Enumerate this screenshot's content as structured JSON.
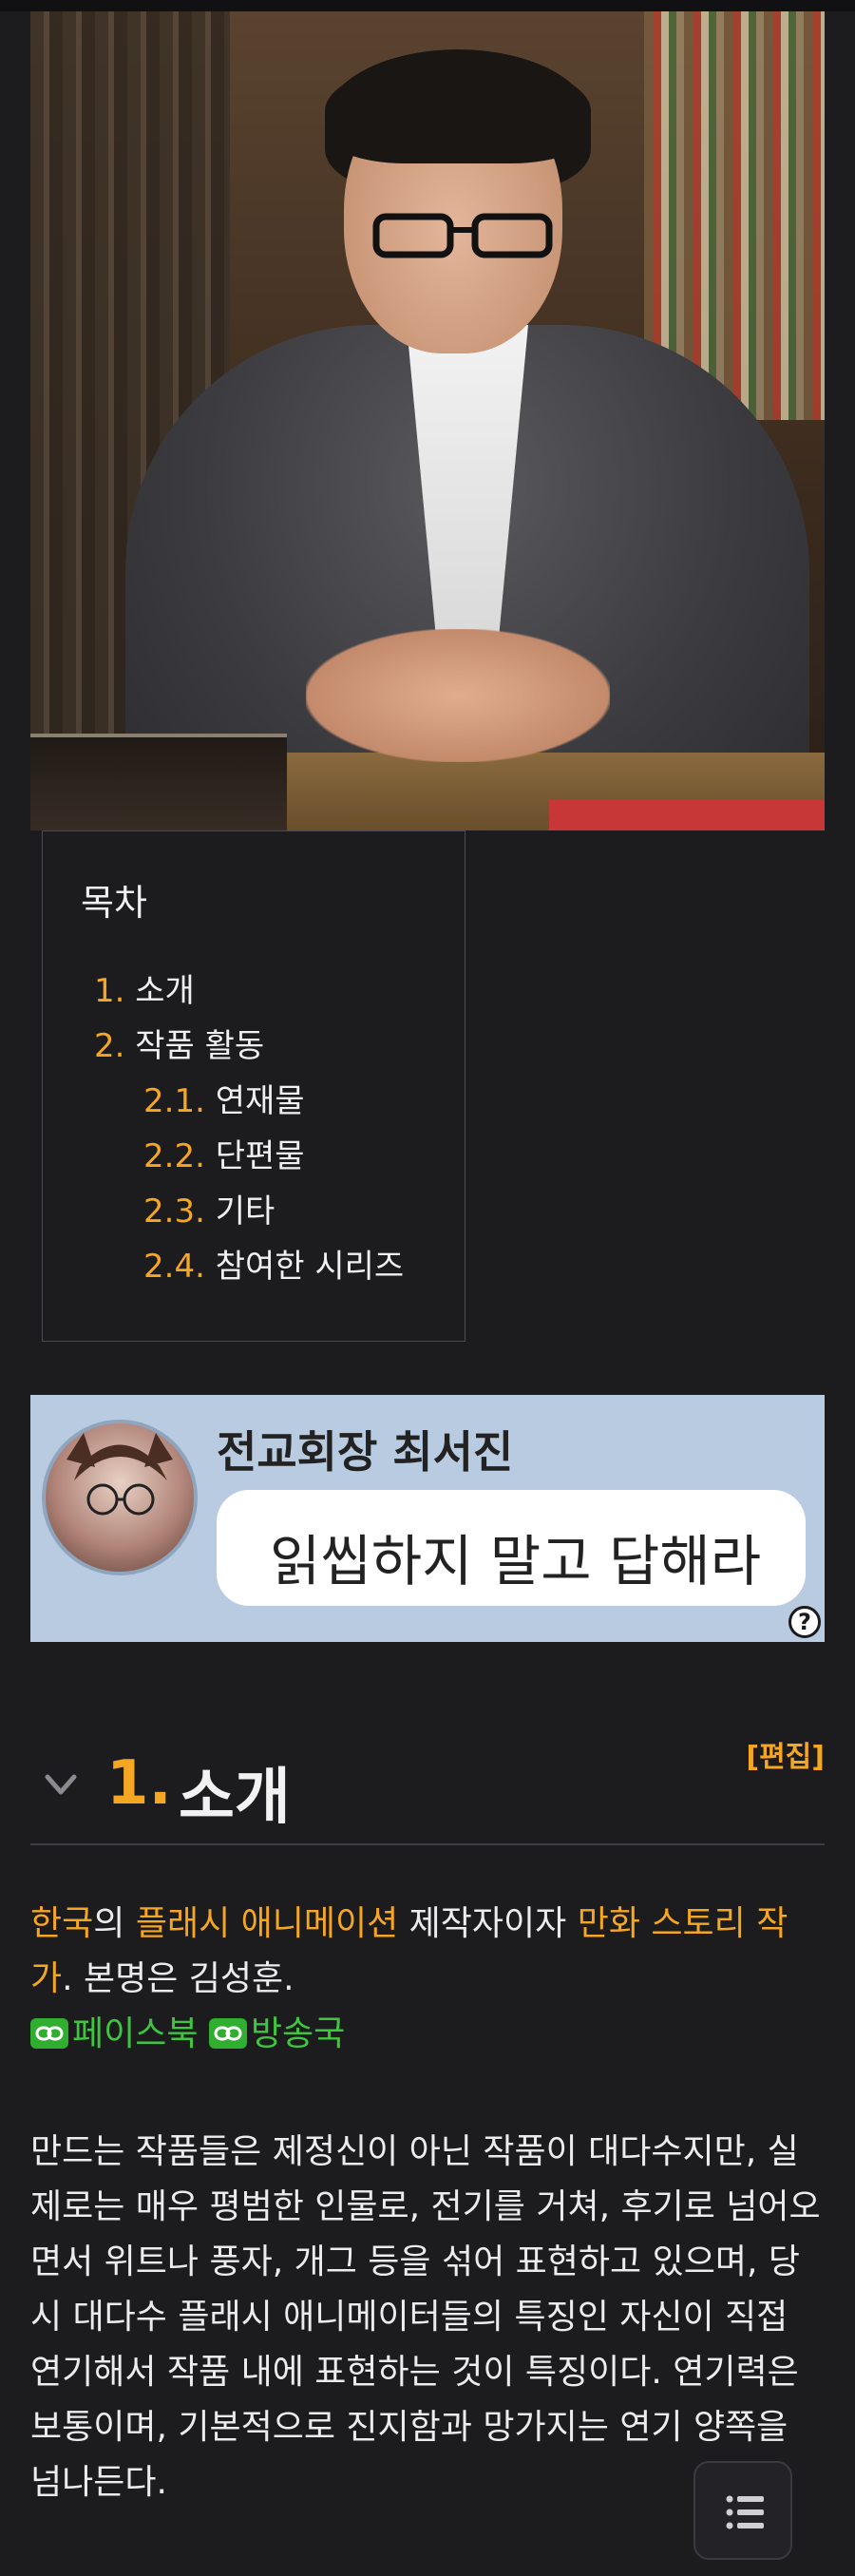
{
  "toc": {
    "title": "목차",
    "items": [
      {
        "num": "1.",
        "label": "소개"
      },
      {
        "num": "2.",
        "label": "작품 활동"
      },
      {
        "num": "2.1.",
        "label": "연재물"
      },
      {
        "num": "2.2.",
        "label": "단편물"
      },
      {
        "num": "2.3.",
        "label": "기타"
      },
      {
        "num": "2.4.",
        "label": "참여한 시리즈"
      }
    ]
  },
  "ad": {
    "name": "전교회장 최서진",
    "bubble": "읽씹하지 말고 답해라",
    "help": "?"
  },
  "section": {
    "num": "1.",
    "title": "소개",
    "edit": "[편집]"
  },
  "intro": {
    "link_korea": "한국",
    "text1": "의 ",
    "link_flash": "플래시 애니메이션",
    "text2": " 제작자이자 ",
    "link_writer": "만화 스토리 작가",
    "text3": ". 본명은 김성훈.",
    "ext_facebook": "페이스북",
    "ext_station": "방송국"
  },
  "body_paragraph": "만드는 작품들은 제정신이 아닌 작품이 대다수지만, 실제로는 매우 평범한 인물로, 전기를 거쳐, 후기로 넘어오면서 위트나 풍자, 개그 등을 섞어 표현하고 있으며, 당시 대다수 플래시 애니메이터들의 특징인 자신이 직접 연기해서 작품 내에 표현하는 것이 특징이다. 연기력은 보통이며, 기본적으로 진지함과 망가지는 연기 양쪽을 넘나든다.",
  "colors": {
    "accent": "#f5a623",
    "external_link": "#3ec63e",
    "background": "#1c1c1f"
  }
}
